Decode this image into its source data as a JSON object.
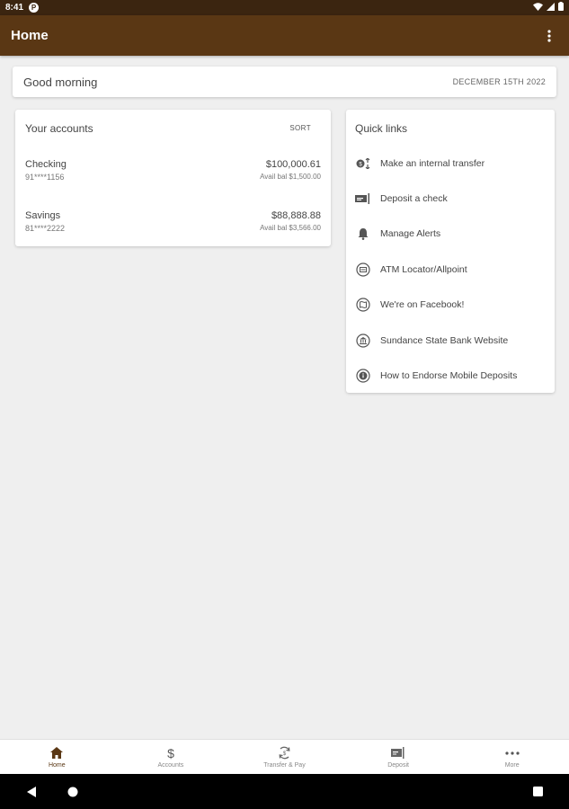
{
  "status_bar": {
    "time": "8:41",
    "p_badge": "P"
  },
  "app_bar": {
    "title": "Home"
  },
  "greeting": {
    "text": "Good morning",
    "date": "DECEMBER 15TH 2022"
  },
  "accounts": {
    "title": "Your accounts",
    "sort_label": "SORT",
    "items": [
      {
        "name": "Checking",
        "number": "91****1156",
        "balance": "$100,000.61",
        "available": "Avail bal $1,500.00"
      },
      {
        "name": "Savings",
        "number": "81****2222",
        "balance": "$88,888.88",
        "available": "Avail bal $3,566.00"
      }
    ]
  },
  "quick_links": {
    "title": "Quick links",
    "items": [
      {
        "label": "Make an internal transfer",
        "icon": "transfer-icon"
      },
      {
        "label": "Deposit a check",
        "icon": "check-deposit-icon"
      },
      {
        "label": "Manage Alerts",
        "icon": "bell-icon"
      },
      {
        "label": "ATM Locator/Allpoint",
        "icon": "atm-icon"
      },
      {
        "label": "We're on Facebook!",
        "icon": "map-icon"
      },
      {
        "label": "Sundance State Bank Website",
        "icon": "bank-icon"
      },
      {
        "label": "How to Endorse Mobile Deposits",
        "icon": "info-icon"
      }
    ]
  },
  "bottom_nav": {
    "items": [
      {
        "label": "Home",
        "icon": "home-icon",
        "active": true
      },
      {
        "label": "Accounts",
        "icon": "dollar-icon",
        "active": false
      },
      {
        "label": "Transfer & Pay",
        "icon": "transfer-pay-icon",
        "active": false
      },
      {
        "label": "Deposit",
        "icon": "deposit-icon",
        "active": false
      },
      {
        "label": "More",
        "icon": "more-icon",
        "active": false
      }
    ]
  },
  "colors": {
    "app_bar": "#5a3714",
    "status_bar": "#3b2510",
    "background": "#efefef",
    "active_nav": "#5a3714"
  }
}
